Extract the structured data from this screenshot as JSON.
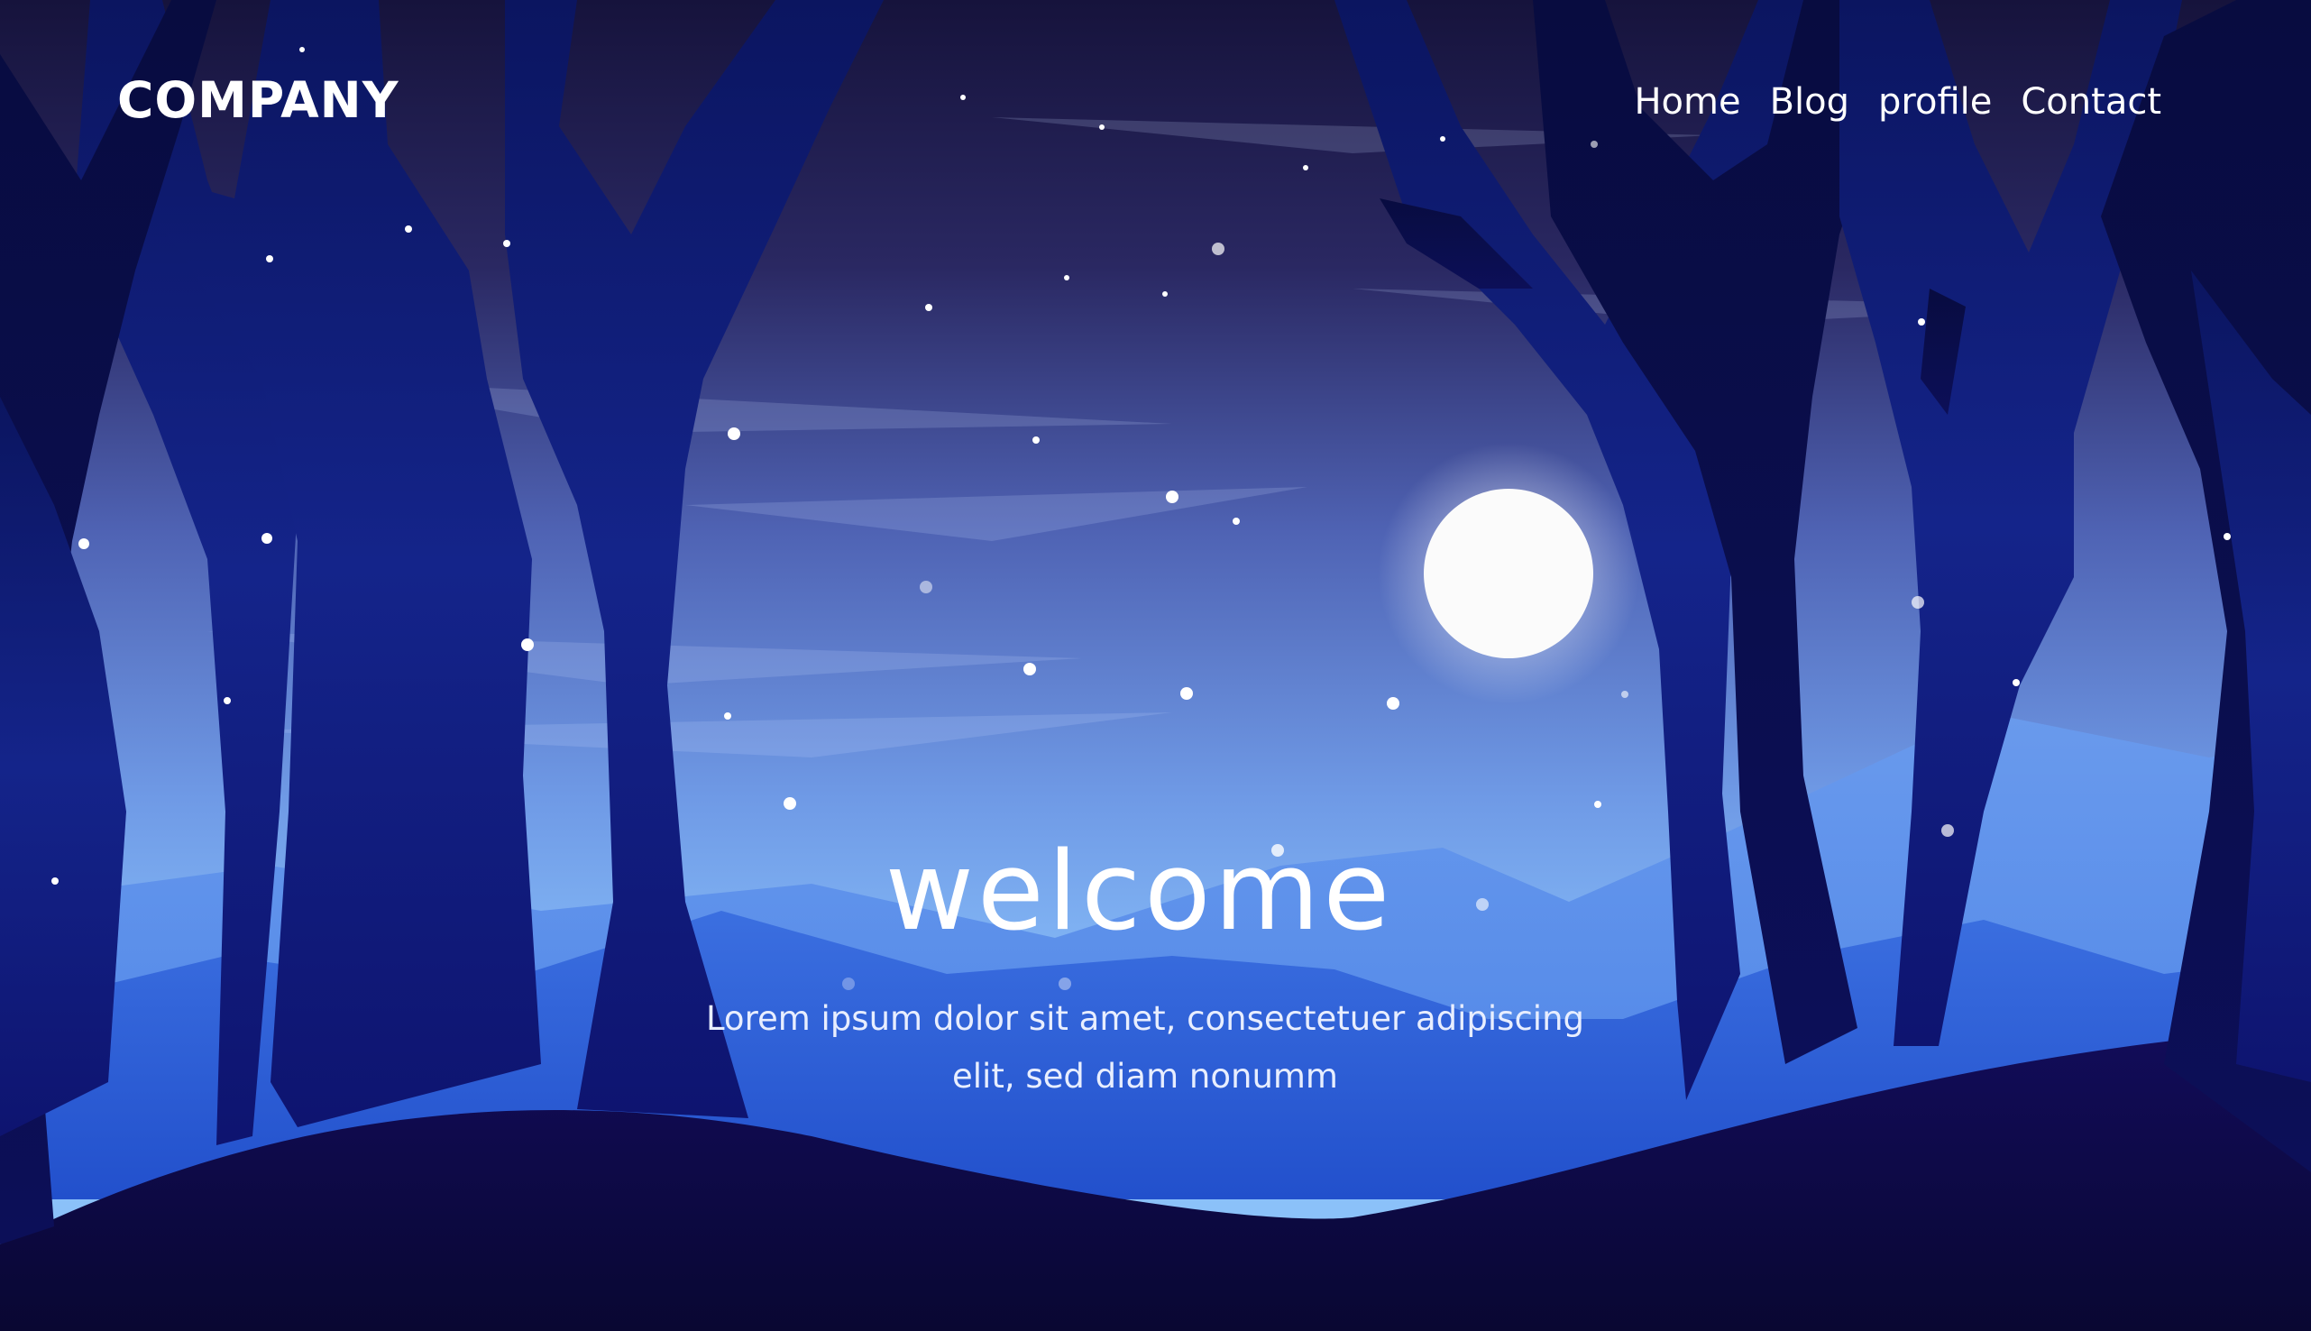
{
  "header": {
    "logo": "COMPANY",
    "nav": [
      {
        "label": "Home"
      },
      {
        "label": "Blog"
      },
      {
        "label": "profile"
      },
      {
        "label": "Contact"
      }
    ]
  },
  "hero": {
    "title": "welcome",
    "subtitle": "Lorem ipsum dolor sit amet, consectetuer adipiscing elit, sed diam nonumm"
  },
  "colors": {
    "sky_top": "#1c1848",
    "sky_mid": "#4e64b8",
    "sky_low": "#7fb2f5",
    "mountain_far": "#5b8be6",
    "mountain_near": "#2f5fd8",
    "tree": "#112080",
    "ground": "#0c0a44",
    "moon": "#fbfbfb"
  }
}
